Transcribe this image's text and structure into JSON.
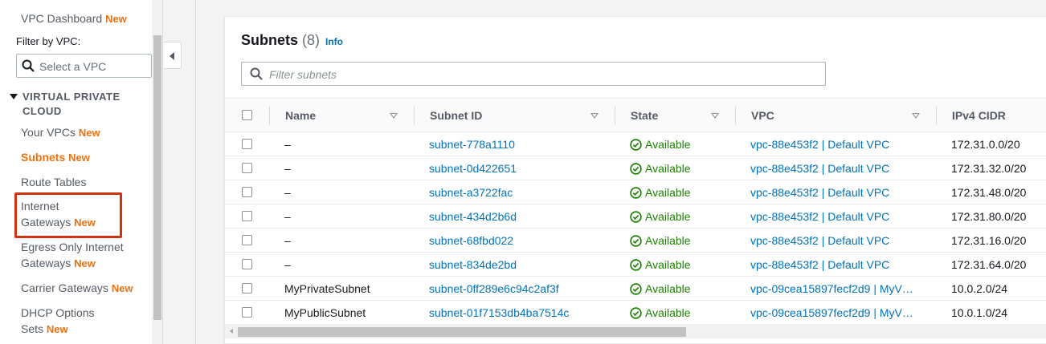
{
  "sidebar": {
    "dashboard": {
      "label": "VPC Dashboard",
      "badge": "New"
    },
    "filter_label": "Filter by VPC:",
    "vpc_select_placeholder": "Select a VPC",
    "section_title": "VIRTUAL PRIVATE CLOUD",
    "items": [
      {
        "label": "Your VPCs",
        "badge": "New"
      },
      {
        "label": "Subnets",
        "badge": "New",
        "active": true
      },
      {
        "label": "Route Tables",
        "badge": ""
      },
      {
        "label_line1": "Internet",
        "label_line2": "Gateways",
        "badge": "New",
        "highlighted": true
      },
      {
        "label_line1": "Egress Only Internet",
        "label_line2": "Gateways",
        "badge": "New"
      },
      {
        "label": "Carrier Gateways",
        "badge": "New"
      },
      {
        "label_line1": "DHCP Options",
        "label_line2": "Sets",
        "badge": "New"
      }
    ]
  },
  "main": {
    "title": "Subnets",
    "count": "(8)",
    "info_link": "Info",
    "filter_placeholder": "Filter subnets",
    "columns": [
      "Name",
      "Subnet ID",
      "State",
      "VPC",
      "IPv4 CIDR"
    ],
    "rows": [
      {
        "name": "–",
        "subnet_id": "subnet-778a1110",
        "state": "Available",
        "vpc": "vpc-88e453f2 | Default VPC",
        "cidr": "172.31.0.0/20"
      },
      {
        "name": "–",
        "subnet_id": "subnet-0d422651",
        "state": "Available",
        "vpc": "vpc-88e453f2 | Default VPC",
        "cidr": "172.31.32.0/20"
      },
      {
        "name": "–",
        "subnet_id": "subnet-a3722fac",
        "state": "Available",
        "vpc": "vpc-88e453f2 | Default VPC",
        "cidr": "172.31.48.0/20"
      },
      {
        "name": "–",
        "subnet_id": "subnet-434d2b6d",
        "state": "Available",
        "vpc": "vpc-88e453f2 | Default VPC",
        "cidr": "172.31.80.0/20"
      },
      {
        "name": "–",
        "subnet_id": "subnet-68fbd022",
        "state": "Available",
        "vpc": "vpc-88e453f2 | Default VPC",
        "cidr": "172.31.16.0/20"
      },
      {
        "name": "–",
        "subnet_id": "subnet-834de2bd",
        "state": "Available",
        "vpc": "vpc-88e453f2 | Default VPC",
        "cidr": "172.31.64.0/20"
      },
      {
        "name": "MyPrivateSubnet",
        "subnet_id": "subnet-0ff289e6c94c2af3f",
        "state": "Available",
        "vpc": "vpc-09cea15897fecf2d9 | MyV…",
        "cidr": "10.0.2.0/24"
      },
      {
        "name": "MyPublicSubnet",
        "subnet_id": "subnet-01f7153db4ba7514c",
        "state": "Available",
        "vpc": "vpc-09cea15897fecf2d9 | MyV…",
        "cidr": "10.0.1.0/24"
      }
    ]
  },
  "colors": {
    "accent_orange": "#ec7211",
    "link_blue": "#0073bb",
    "success_green": "#1d8102",
    "highlight_red": "#d13212"
  }
}
